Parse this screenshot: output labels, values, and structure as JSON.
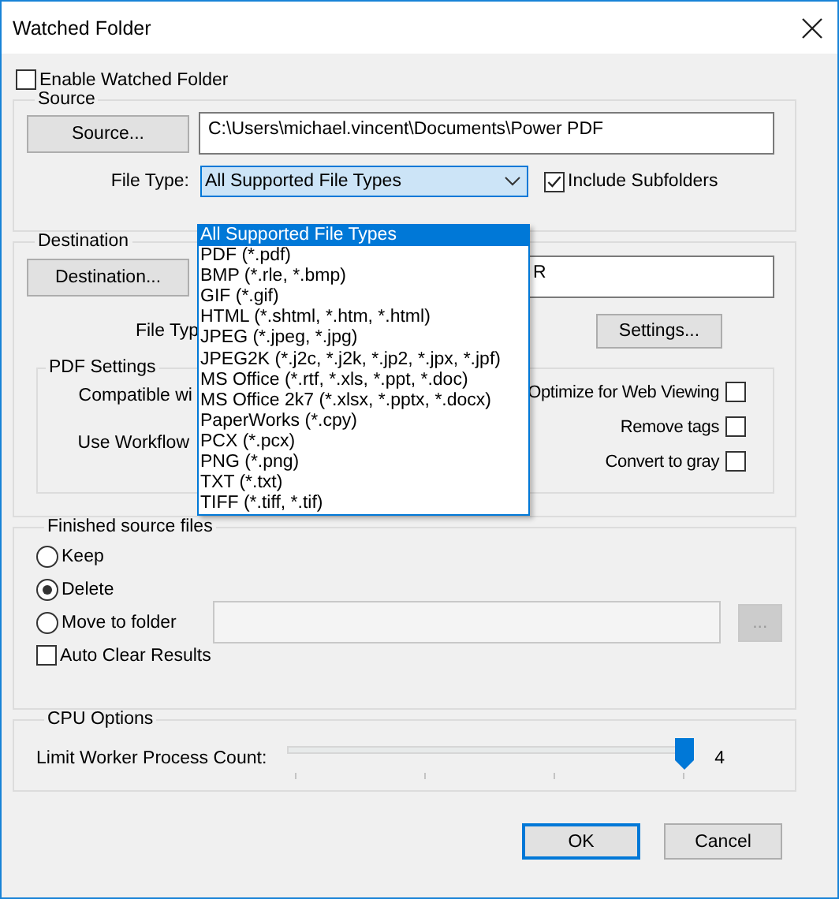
{
  "window": {
    "title": "Watched Folder"
  },
  "enable_watched_folder": {
    "label": "Enable Watched Folder",
    "checked": false
  },
  "source": {
    "title": "Source",
    "button": "Source...",
    "path": "C:\\Users\\michael.vincent\\Documents\\Power PDF",
    "file_type_label": "File Type:",
    "file_type": "All Supported File Types",
    "include_subfolders": {
      "label": "Include Subfolders",
      "checked": true
    }
  },
  "file_type_dropdown": {
    "options": [
      {
        "label": "All Supported File Types",
        "selected": true
      },
      {
        "label": "PDF (*.pdf)",
        "selected": false
      },
      {
        "label": "BMP (*.rle, *.bmp)",
        "selected": false
      },
      {
        "label": "GIF (*.gif)",
        "selected": false
      },
      {
        "label": "HTML (*.shtml, *.htm, *.html)",
        "selected": false
      },
      {
        "label": "JPEG (*.jpeg, *.jpg)",
        "selected": false
      },
      {
        "label": "JPEG2K (*.j2c, *.j2k, *.jp2, *.jpx, *.jpf)",
        "selected": false
      },
      {
        "label": "MS Office (*.rtf, *.xls, *.ppt, *.doc)",
        "selected": false
      },
      {
        "label": "MS Office 2k7 (*.xlsx, *.pptx, *.docx)",
        "selected": false
      },
      {
        "label": "PaperWorks (*.cpy)",
        "selected": false
      },
      {
        "label": "PCX (*.pcx)",
        "selected": false
      },
      {
        "label": "PNG (*.png)",
        "selected": false
      },
      {
        "label": "TXT (*.txt)",
        "selected": false
      },
      {
        "label": "TIFF (*.tiff, *.tif)",
        "selected": false
      }
    ]
  },
  "destination": {
    "title": "Destination",
    "button": "Destination...",
    "path": "R",
    "file_type_label": "File Typ",
    "settings_button": "Settings...",
    "pdf_settings": {
      "title": "PDF Settings",
      "compatible_label": "Compatible wi",
      "workflow_label": "Use Workflow",
      "options": [
        {
          "label": "Optimize for Web Viewing",
          "checked": false
        },
        {
          "label": "Remove tags",
          "checked": false
        },
        {
          "label": "Convert to gray",
          "checked": false
        }
      ]
    }
  },
  "finished_source_files": {
    "title": "Finished source files",
    "options": [
      {
        "label": "Keep",
        "selected": false
      },
      {
        "label": "Delete",
        "selected": true
      },
      {
        "label": "Move to folder",
        "selected": false
      }
    ],
    "folder_button": {
      "label": "...",
      "disabled": true
    },
    "auto_clear_results": {
      "label": "Auto Clear Results",
      "checked": false
    }
  },
  "cpu_options": {
    "title": "CPU Options",
    "label": "Limit Worker Process Count:",
    "level": 1,
    "reading": "4"
  },
  "buttons": [
    {
      "label": "OK",
      "default": true
    },
    {
      "label": "Cancel",
      "default": false
    }
  ]
}
